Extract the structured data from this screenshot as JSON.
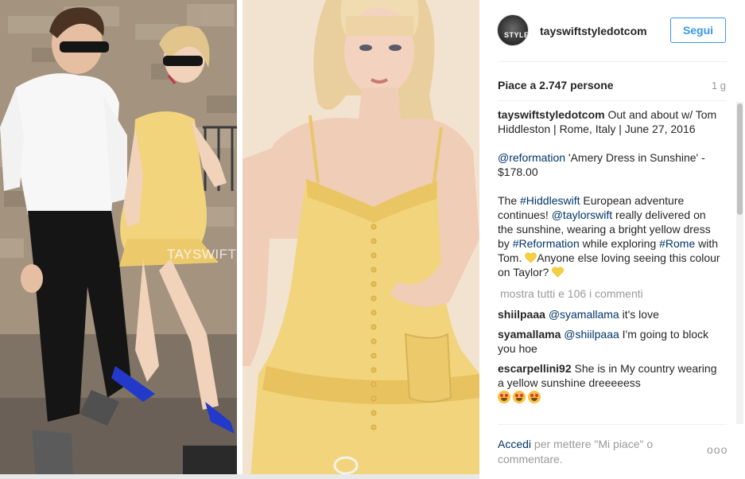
{
  "photo": {
    "watermark": "TAYSWIFTSTYLE.COM"
  },
  "header": {
    "avatar_text": "STYLE",
    "username": "tayswiftstyledotcom",
    "follow_label": "Segui"
  },
  "meta": {
    "likes": "Piace a 2.747 persone",
    "time_ago": "1 g"
  },
  "caption": {
    "username": "tayswiftstyledotcom",
    "line1": " Out and about w/ Tom Hiddleston | Rome, Italy | June 27, 2016",
    "mention_reformation": "@reformation",
    "dress_text": " 'Amery Dress in Sunshine' - $178.00",
    "p3_start": "The ",
    "hashtag_hiddleswift": "#Hiddleswift",
    "p3_a": " European adventure continues! ",
    "mention_taylorswift": "@taylorswift",
    "p3_b": " really delivered on the sunshine, wearing a bright yellow dress by ",
    "hashtag_reformation": "#Reformation",
    "p3_c": " while exploring ",
    "hashtag_rome": "#Rome",
    "p3_d": " with Tom. ",
    "p3_e": "Anyone else loving seeing this colour on Taylor? "
  },
  "view_all_comments": "mostra tutti e 106 i commenti",
  "comments": [
    {
      "user": "shiilpaaa",
      "mention": "@syamallama",
      "text": " it's love"
    },
    {
      "user": "syamallama",
      "mention": "@shiilpaaa",
      "text": " I'm going to block you hoe"
    },
    {
      "user": "escarpellini92",
      "mention": "",
      "text": " She is in My country wearing a yellow sunshine dreeeeess"
    }
  ],
  "footer": {
    "login_label": "Accedi",
    "rest": " per mettere \"Mi piace\" o commentare.",
    "more_options": "ooo"
  },
  "colors": {
    "accent": "#3897f0",
    "link": "#003569",
    "muted": "#999999",
    "dress_yellow": "#f2d47c",
    "heart_yellow": "#f5d040"
  },
  "icons": {
    "heart": "yellow-heart-icon",
    "face": "heart-eyes-face-icon"
  }
}
